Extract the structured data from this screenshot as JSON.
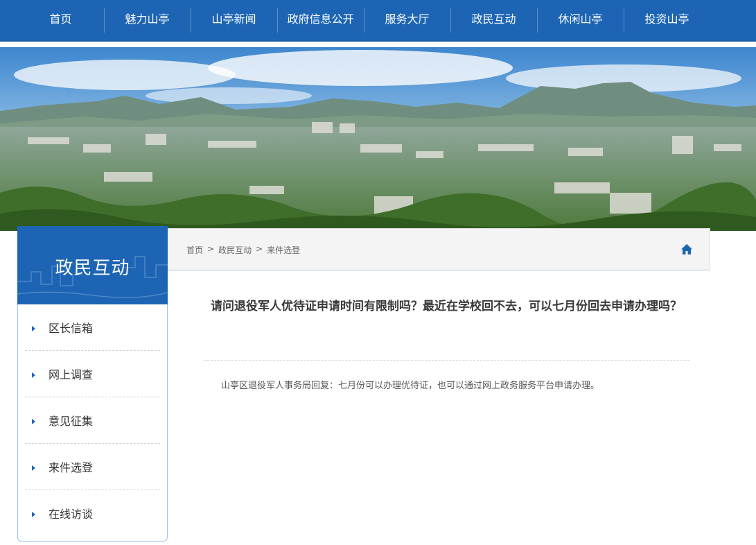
{
  "nav": {
    "items": [
      "首页",
      "魅力山亭",
      "山亭新闻",
      "政府信息公开",
      "服务大厅",
      "政民互动",
      "休闲山亭",
      "投资山亭"
    ]
  },
  "banner": {
    "description": "city landscape with mountains"
  },
  "sidebar": {
    "title": "政民互动",
    "items": [
      "区长信箱",
      "网上调查",
      "意见征集",
      "来件选登",
      "在线访谈"
    ]
  },
  "breadcrumb": {
    "items": [
      "首页",
      "政民互动",
      "来件选登"
    ],
    "separator": ">",
    "home_icon": "home-icon"
  },
  "article": {
    "title": "请问退役军人优待证申请时间有限制吗？最近在学校回不去，可以七月份回去申请办理吗？",
    "reply": "山亭区退役军人事务局回复：七月份可以办理优待证，也可以通过网上政务服务平台申请办理。"
  },
  "colors": {
    "primary": "#1d65b4",
    "border_light": "#9dc3e6",
    "breadcrumb_bg": "#f4f4f4"
  }
}
